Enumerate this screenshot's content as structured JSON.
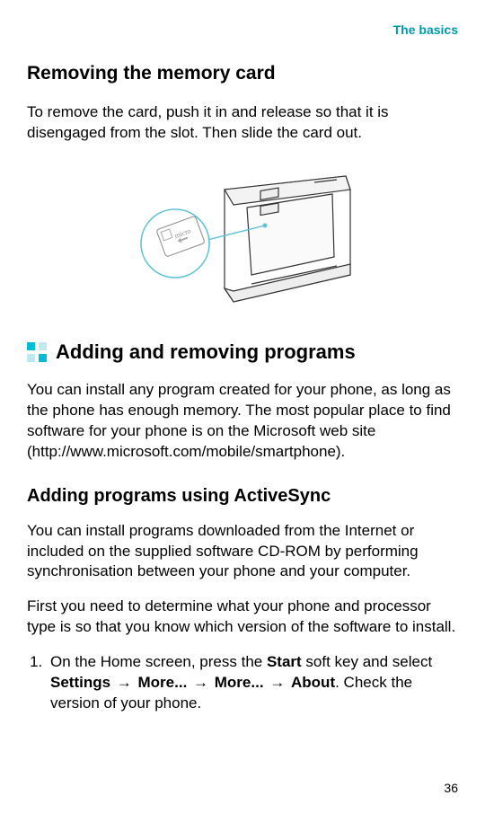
{
  "chapter": "The basics",
  "heading1": "Removing the memory card",
  "para1": "To remove the card, push it in and release so that it is disengaged from the slot. Then slide the card out.",
  "callout_label": "micro",
  "section2": "Adding and removing programs",
  "para2": "You can install any program created for your phone, as long as the phone has enough memory. The most popular place to find software for your phone is on the Microsoft web site (http://www.microsoft.com/mobile/smartphone).",
  "heading2": "Adding programs using ActiveSync",
  "para3": "You can install programs downloaded from the Internet or included on the supplied software CD-ROM by performing synchronisation between your phone and your computer.",
  "para4": "First you need to determine what your phone and processor type is so that you know which version of the software to install.",
  "step1": {
    "pre": "On the Home screen, press the ",
    "b1": "Start",
    "mid1": " soft key and select ",
    "b2": "Settings",
    "arrow": " → ",
    "b3": "More...",
    "b4": "More...",
    "b5": "About",
    "post": ". Check the version of your phone."
  },
  "page_number": "36"
}
